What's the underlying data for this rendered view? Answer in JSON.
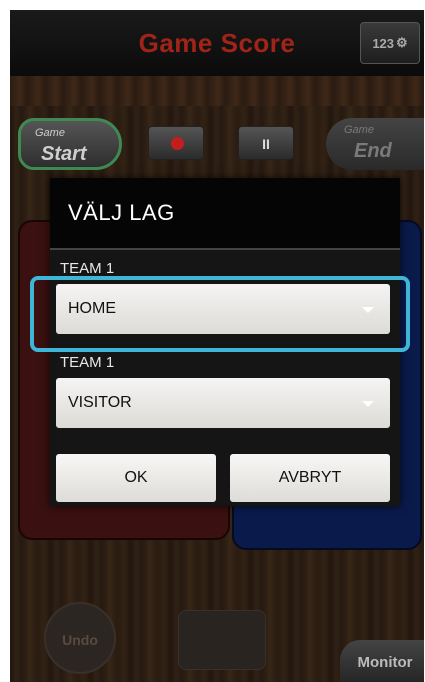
{
  "app": {
    "title": "Game Score",
    "settings_label": "123"
  },
  "controls": {
    "start_small": "Game",
    "start_big": "Start",
    "pause_label": "II",
    "end_small": "Game",
    "end_big": "End"
  },
  "bottom": {
    "undo_label": "Undo",
    "monitor_label": "Monitor"
  },
  "dialog": {
    "title": "VÄLJ LAG",
    "team1_label": "TEAM 1",
    "team1_value": "HOME",
    "team2_label": "TEAM 1",
    "team2_value": "VISITOR",
    "ok_label": "OK",
    "cancel_label": "AVBRYT"
  },
  "colors": {
    "title_red": "#a02418",
    "highlight": "#3fb6d8",
    "start_border": "#3f8a52"
  }
}
